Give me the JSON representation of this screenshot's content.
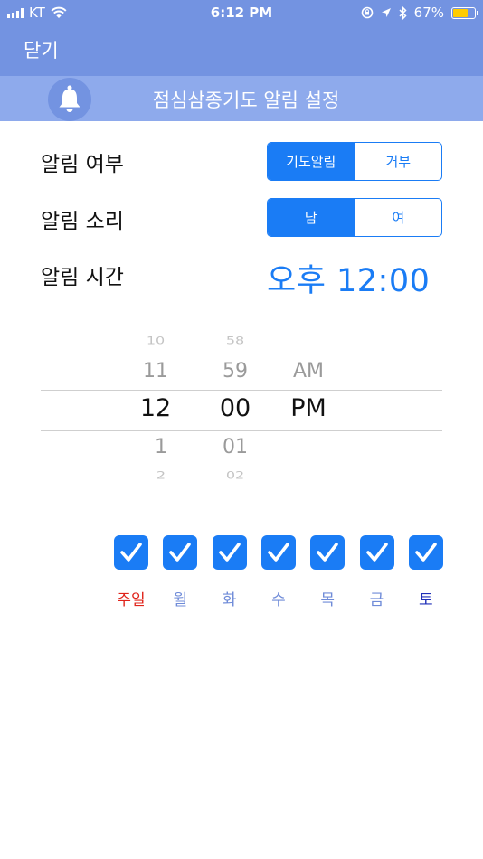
{
  "status_bar": {
    "carrier": "KT",
    "time": "6:12 PM",
    "battery_percent": "67%",
    "battery_level": 0.67,
    "icons": [
      "signal-icon",
      "wifi-icon",
      "lock-rotation-icon",
      "location-icon",
      "bluetooth-icon",
      "battery-icon"
    ]
  },
  "nav": {
    "close_label": "닫기"
  },
  "header": {
    "title": "점심삼종기도 알림 설정",
    "icon": "bell-icon"
  },
  "settings": {
    "alarm_enabled": {
      "label": "알림 여부",
      "options": [
        "기도알림",
        "거부"
      ],
      "selected": "기도알림"
    },
    "alarm_sound": {
      "label": "알림 소리",
      "options": [
        "남",
        "여"
      ],
      "selected": "남"
    },
    "alarm_time": {
      "label": "알림 시간",
      "value": "오후 12:00"
    }
  },
  "picker": {
    "hours": {
      "far_above": "10",
      "above": "11",
      "selected": "12",
      "below": "1",
      "far_below": "2"
    },
    "minutes": {
      "far_above": "58",
      "above": "59",
      "selected": "00",
      "below": "01",
      "far_below": "02"
    },
    "period": {
      "above": "AM",
      "selected": "PM"
    }
  },
  "days": [
    {
      "label": "주일",
      "checked": true,
      "color": "#e0241b"
    },
    {
      "label": "월",
      "checked": true,
      "color": "#6f8bd8"
    },
    {
      "label": "화",
      "checked": true,
      "color": "#6f8bd8"
    },
    {
      "label": "수",
      "checked": true,
      "color": "#6f8bd8"
    },
    {
      "label": "목",
      "checked": true,
      "color": "#6f8bd8"
    },
    {
      "label": "금",
      "checked": true,
      "color": "#6f8bd8"
    },
    {
      "label": "토",
      "checked": true,
      "color": "#1f2fb8"
    }
  ],
  "colors": {
    "nav_bar": "#7393e1",
    "title_bar": "#8eaaec",
    "accent": "#1a7cf5"
  }
}
